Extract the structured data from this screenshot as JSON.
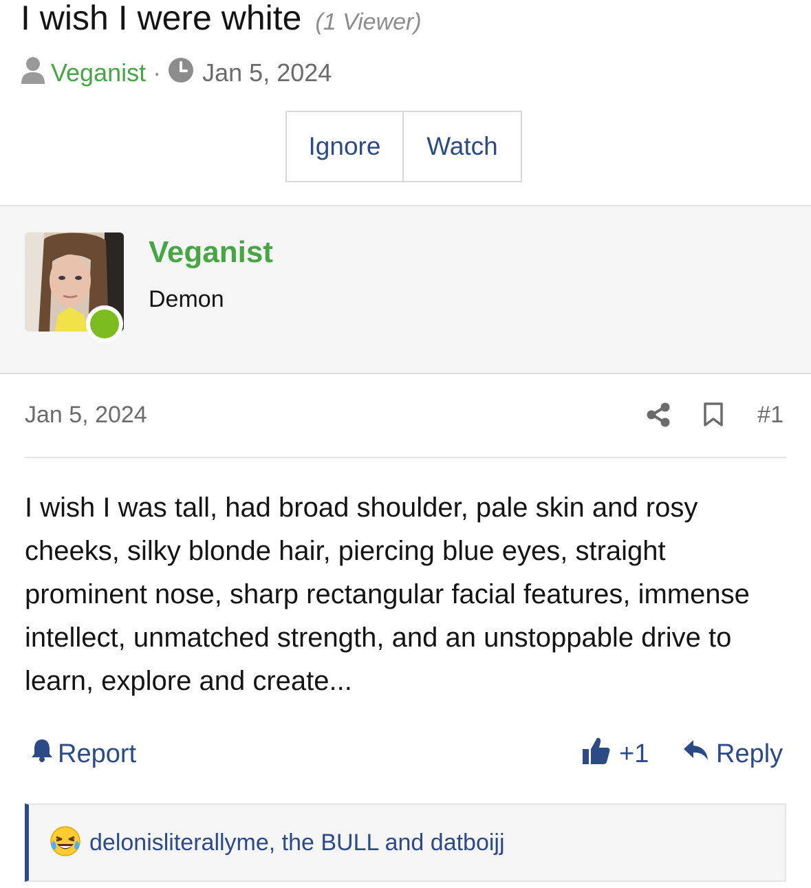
{
  "thread": {
    "title": "I wish I were white",
    "viewer_count": "(1 Viewer)",
    "author": "Veganist",
    "separator": "·",
    "date": "Jan 5, 2024"
  },
  "buttons": {
    "ignore": "Ignore",
    "watch": "Watch"
  },
  "poster": {
    "name": "Veganist",
    "user_title": "Demon",
    "online": true
  },
  "post": {
    "date": "Jan 5, 2024",
    "number": "#1",
    "body": "I wish I was tall, had broad shoulder, pale skin and rosy cheeks, silky blonde hair, piercing blue eyes, straight prominent nose, sharp rectangular facial features, immense intellect, unmatched strength, and an unstoppable drive to learn, explore and create..."
  },
  "actions": {
    "report": "Report",
    "like_count": "+1",
    "reply": "Reply"
  },
  "reactions": {
    "emoji": "😂",
    "users": "delonisliterallyme, the BULL and datboijj"
  },
  "colors": {
    "accent": "#2c4a86",
    "username": "#47a544",
    "online": "#7cbc20",
    "muted": "#6b6b6b"
  },
  "icons": [
    "user-icon",
    "clock-icon",
    "share-icon",
    "bookmark-icon",
    "bell-icon",
    "thumbs-up-icon",
    "reply-icon",
    "laughing-tears-emoji"
  ]
}
